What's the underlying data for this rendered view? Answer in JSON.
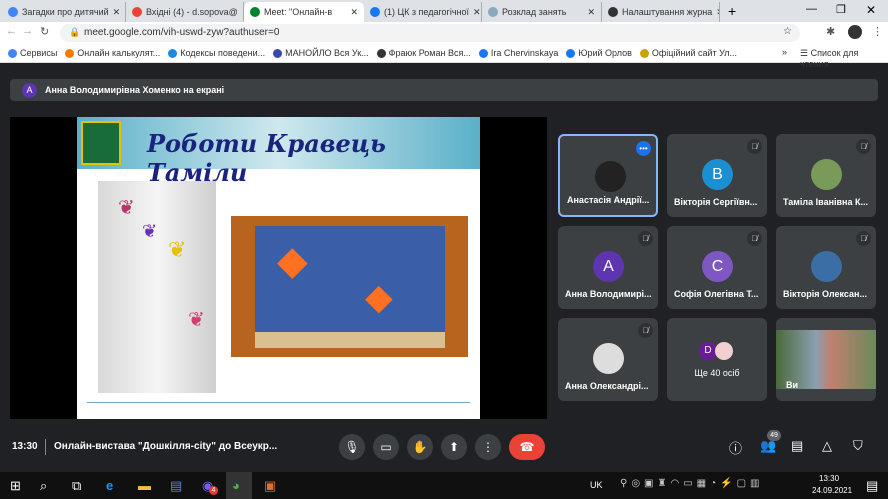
{
  "browser": {
    "tabs": [
      {
        "title": "Загадки про дитячий",
        "color": "#4285f4"
      },
      {
        "title": "Вхідні (4) - d.sopova@",
        "color": "#ea4335"
      },
      {
        "title": "Meet: \"Онлайн-в",
        "color": "#00832d",
        "active": true
      },
      {
        "title": "(1) ЦК з педагогічної",
        "color": "#1877f2"
      },
      {
        "title": "Розклад занять",
        "color": "#8ab"
      },
      {
        "title": "Налаштування журна",
        "color": "#333"
      }
    ],
    "url": "meet.google.com/vih-uswd-zyw?authuser=0",
    "bookmarks": [
      "Сервисы",
      "Онлайн калькулят...",
      "Кодексы поведени...",
      "МАНОЙЛО Вся Ук...",
      "Фраюк Роман Вся...",
      "Ira Chervinskaya",
      "Юрий Орлов",
      "Офіційний сайт Ул..."
    ],
    "reading_list": "Список для чтения"
  },
  "banner": {
    "avatar": "A",
    "text": "Анна Володимирівна Хоменко на екрані"
  },
  "slide": {
    "title": "Роботи Кравець Таміли"
  },
  "participants": [
    {
      "name": "Анастасія Андрії...",
      "type": "photo",
      "color": "#222"
    },
    {
      "name": "Вікторія Сергіївн...",
      "initial": "B",
      "color": "#1a8fd1",
      "muted": true
    },
    {
      "name": "Таміла Іванівна К...",
      "type": "photo",
      "color": "#7a9a5a",
      "muted": true
    },
    {
      "name": "Анна Володимирі...",
      "initial": "A",
      "color": "#5e35b1",
      "muted": true
    },
    {
      "name": "Софія Олегівна Т...",
      "initial": "C",
      "color": "#7e57c2",
      "muted": true
    },
    {
      "name": "Вікторія Олексан...",
      "type": "photo",
      "color": "#3a6ea5",
      "muted": true
    },
    {
      "name": "Анна Олександрі...",
      "type": "photo",
      "color": "#ddd",
      "muted": true
    }
  ],
  "more": {
    "initial": "D",
    "label": "Ще 40 осіб"
  },
  "self": {
    "label": "Ви"
  },
  "meeting": {
    "time": "13:30",
    "title": "Онлайн-вистава \"Дошкілля-city\" до Всеукр...",
    "participant_count": "49"
  },
  "taskbar": {
    "lang": "UK",
    "time": "13:30",
    "date": "24.09.2021",
    "viber_badge": "4"
  }
}
